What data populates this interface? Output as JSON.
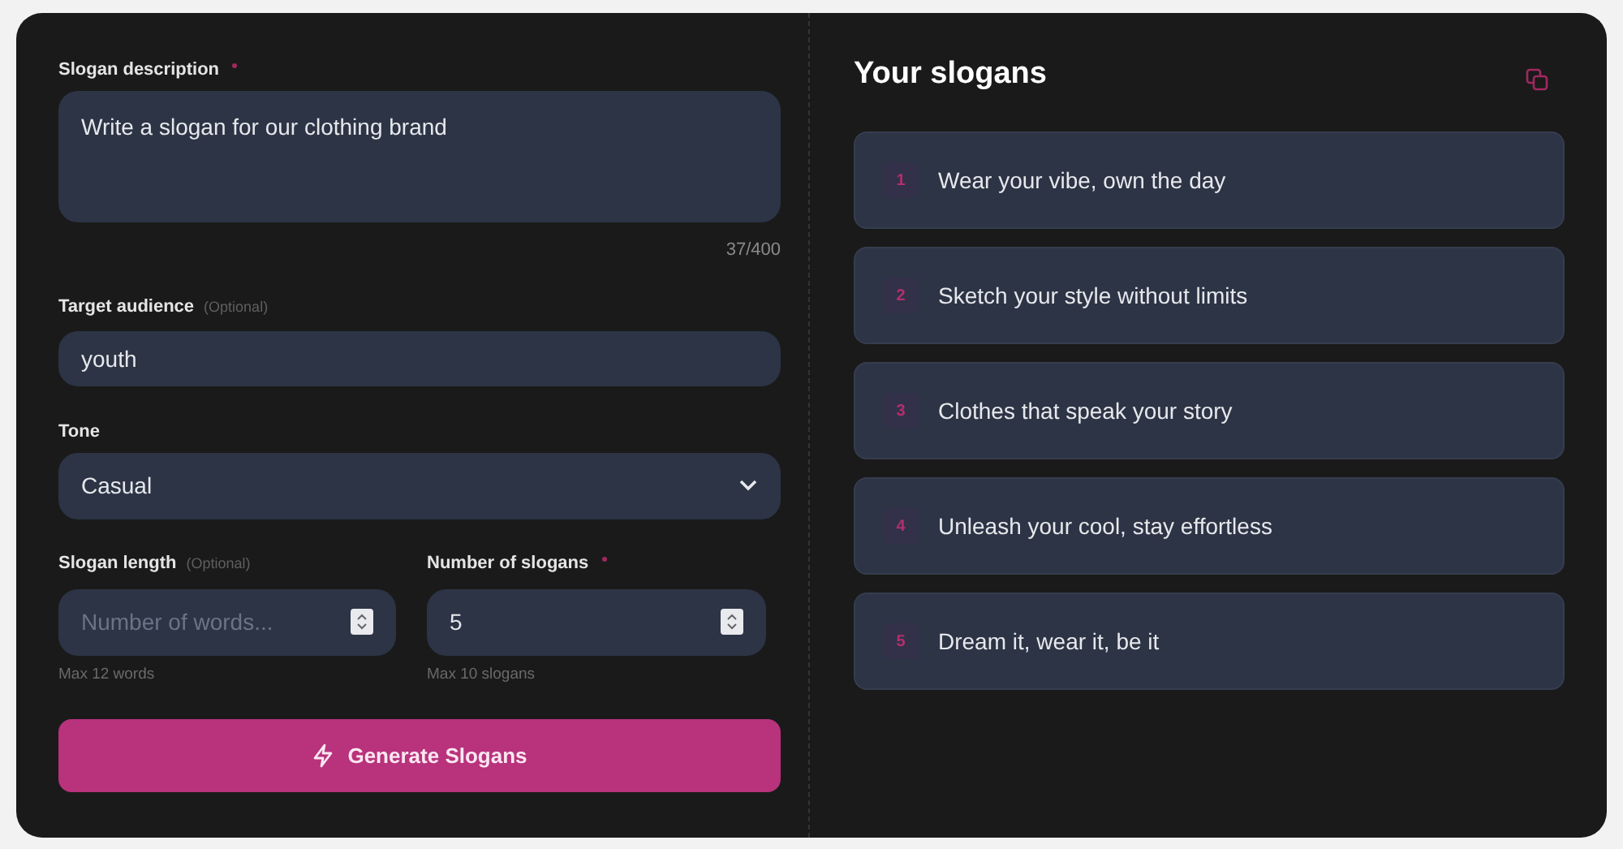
{
  "form": {
    "description": {
      "label": "Slogan description",
      "required": true,
      "value": "Write a slogan for our clothing brand",
      "counter": "37/400"
    },
    "audience": {
      "label": "Target audience",
      "optional_note": "(Optional)",
      "value": "youth"
    },
    "tone": {
      "label": "Tone",
      "value": "Casual"
    },
    "length": {
      "label": "Slogan length",
      "optional_note": "(Optional)",
      "placeholder": "Number of words...",
      "hint": "Max 12 words"
    },
    "count": {
      "label": "Number of slogans",
      "required": true,
      "value": "5",
      "hint": "Max 10 slogans"
    },
    "submit": {
      "label": "Generate Slogans"
    }
  },
  "results": {
    "title": "Your slogans",
    "slogans": [
      {
        "number": "1",
        "text": "Wear your vibe, own the day"
      },
      {
        "number": "2",
        "text": "Sketch your style without limits"
      },
      {
        "number": "3",
        "text": "Clothes that speak your story"
      },
      {
        "number": "4",
        "text": "Unleash your cool, stay effortless"
      },
      {
        "number": "5",
        "text": "Dream it, wear it, be it"
      }
    ]
  }
}
